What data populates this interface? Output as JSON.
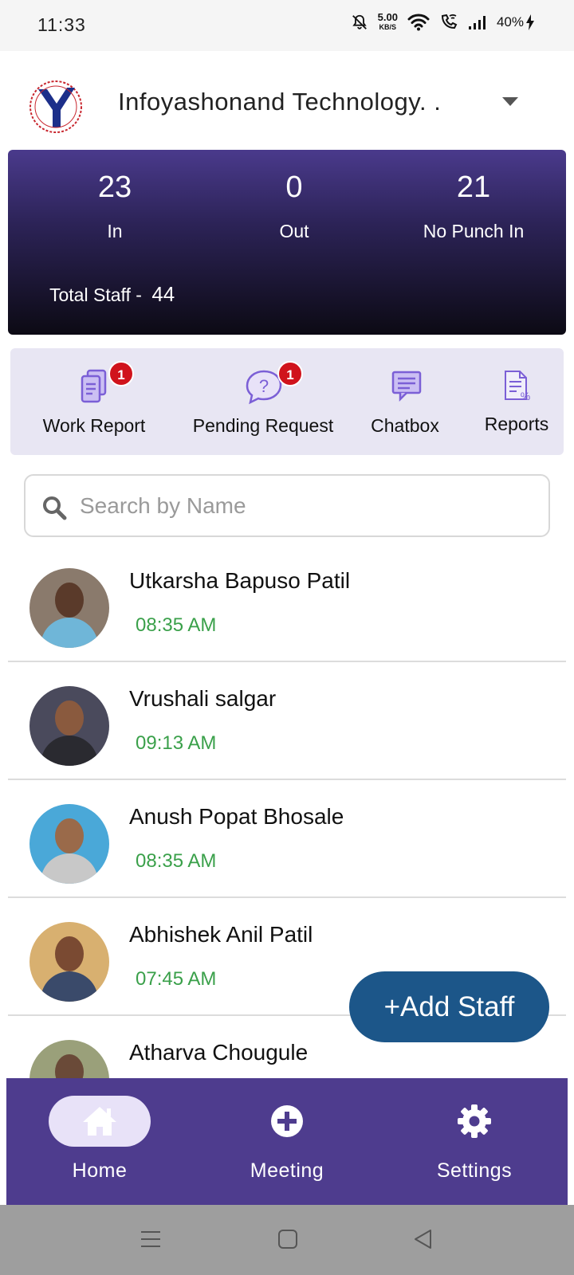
{
  "status_bar": {
    "time": "11:33",
    "net_speed_value": "5.00",
    "net_speed_unit": "KB/S",
    "battery": "40%"
  },
  "header": {
    "company_name": "Infoyashonand Technology. .",
    "logo_icon": "infoyashonand-logo"
  },
  "stats": {
    "in_value": "23",
    "in_label": "In",
    "out_value": "0",
    "out_label": "Out",
    "nopunch_value": "21",
    "nopunch_label": "No Punch In",
    "total_label": "Total Staff  -",
    "total_value": "44"
  },
  "actions": {
    "work_report": {
      "label": "Work Report",
      "badge": "1",
      "icon": "document-copy-icon"
    },
    "pending_request": {
      "label": "Pending Request",
      "badge": "1",
      "icon": "question-bubble-icon"
    },
    "chatbox": {
      "label": "Chatbox",
      "icon": "chat-icon"
    },
    "reports": {
      "label": "Reports",
      "icon": "report-percent-icon"
    }
  },
  "search": {
    "placeholder": "Search by Name"
  },
  "staff": [
    {
      "name": "Utkarsha Bapuso Patil",
      "time": "08:35 AM"
    },
    {
      "name": "Vrushali salgar",
      "time": "09:13 AM"
    },
    {
      "name": "Anush Popat Bhosale",
      "time": "08:35 AM"
    },
    {
      "name": "Abhishek Anil Patil",
      "time": "07:45 AM"
    },
    {
      "name": "Atharva Chougule",
      "time": ""
    }
  ],
  "fab": {
    "label": "+Add Staff"
  },
  "bottom_nav": {
    "home": "Home",
    "meeting": "Meeting",
    "settings": "Settings"
  },
  "colors": {
    "primary": "#4e3c8e",
    "fab": "#1c5689",
    "time_green": "#3aa04a",
    "badge_red": "#d0131c",
    "icon_purple": "#7b5fd6"
  }
}
